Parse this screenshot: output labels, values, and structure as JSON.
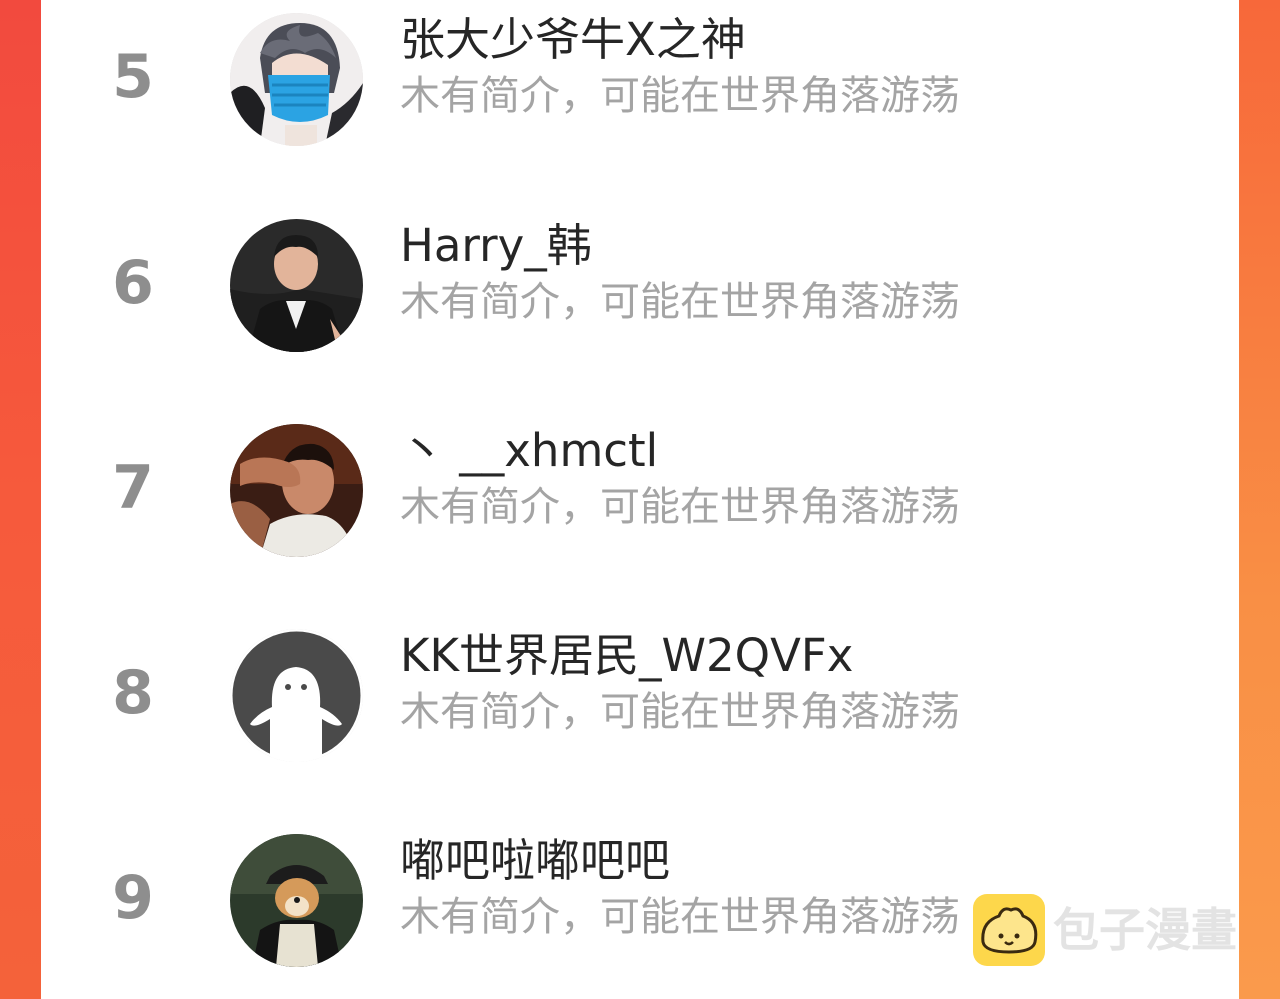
{
  "ranking": [
    {
      "rank": "5",
      "name": "张大少爷牛X之神",
      "bio": "木有简介，可能在世界角落游荡",
      "avatar_icon": "anime-masked-boy-avatar"
    },
    {
      "rank": "6",
      "name": "Harry_韩",
      "bio": "木有简介，可能在世界角落游荡",
      "avatar_icon": "man-in-suit-avatar"
    },
    {
      "rank": "7",
      "name": "丶 __xhmctl",
      "bio": "木有简介，可能在世界角落游荡",
      "avatar_icon": "man-covering-face-avatar"
    },
    {
      "rank": "8",
      "name": "KK世界居民_W2QVFx",
      "bio": "木有简介，可能在世界角落游荡",
      "avatar_icon": "default-ghost-avatar"
    },
    {
      "rank": "9",
      "name": "嘟吧啦嘟吧吧",
      "bio": "木有简介，可能在世界角落游荡",
      "avatar_icon": "shiba-dog-in-cap-avatar"
    }
  ],
  "watermark": {
    "text": "包子漫畫",
    "icon": "bun-mascot-icon"
  },
  "colors": {
    "background_left": "#f24a3e",
    "background_right": "#f98f45",
    "panel": "#ffffff",
    "rank": "#8e8e8e",
    "name": "#262626",
    "bio": "#a4a4a4"
  }
}
